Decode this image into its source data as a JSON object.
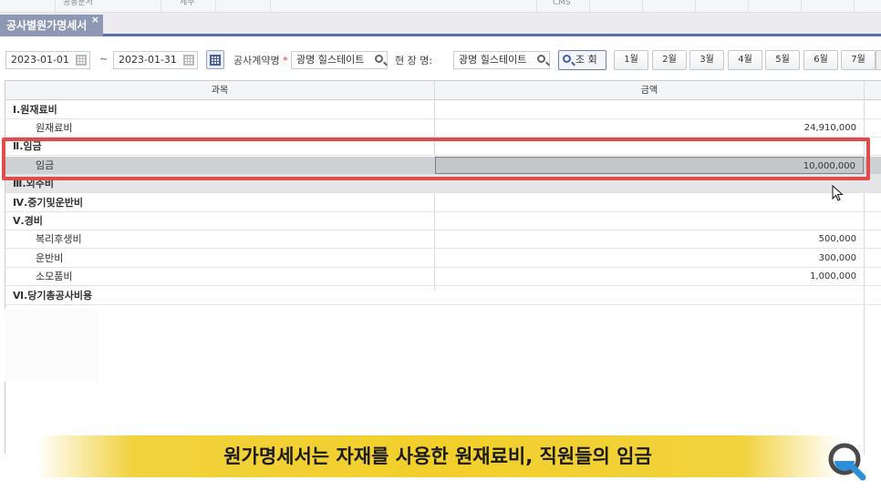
{
  "menu_strip": {
    "fragments": [
      "공통문서",
      "세무",
      "CMS"
    ]
  },
  "tab": {
    "title": "공사별원가명세서",
    "close": "×"
  },
  "toolbar": {
    "date_from": "2023-01-01",
    "separator": "~",
    "date_to": "2023-01-31",
    "contract_label": "공사계약명",
    "required_mark": "*",
    "contract_value": "광명 힐스테이트",
    "site_label": "현 장 명:",
    "site_value": "광명 힐스테이트",
    "query_button": "조 회",
    "months": [
      "1월",
      "2월",
      "3월",
      "4월",
      "5월",
      "6월",
      "7월"
    ]
  },
  "grid": {
    "headers": {
      "subject": "과목",
      "amount": "금액"
    },
    "rows": [
      {
        "kind": "category",
        "label": "Ⅰ.원재료비",
        "amount": ""
      },
      {
        "kind": "item",
        "label": "원재료비",
        "amount": "24,910,000"
      },
      {
        "kind": "category",
        "label": "Ⅱ.임금",
        "amount": ""
      },
      {
        "kind": "item",
        "label": "임금",
        "amount": "10,000,000",
        "selected": true
      },
      {
        "kind": "category",
        "label": "Ⅲ.외주비",
        "amount": ""
      },
      {
        "kind": "category",
        "label": "Ⅳ.중기및운반비",
        "amount": ""
      },
      {
        "kind": "category",
        "label": "Ⅴ.경비",
        "amount": ""
      },
      {
        "kind": "item",
        "label": "복리후생비",
        "amount": "500,000"
      },
      {
        "kind": "item",
        "label": "운반비",
        "amount": "300,000"
      },
      {
        "kind": "item",
        "label": "소모품비",
        "amount": "1,000,000"
      },
      {
        "kind": "category",
        "label": "Ⅵ.당기총공사비용",
        "amount": ""
      }
    ]
  },
  "caption": "원가명세서는 자재를 사용한 원재료비, 직원들의 임금",
  "colors": {
    "highlight": "#e14b4b",
    "caption_bg": "#f2cf2a",
    "tab_bg": "#8e97b3",
    "accent": "#5b6ea8"
  },
  "icons": [
    "calendar-icon",
    "search-icon",
    "mouse-cursor-icon",
    "magnifier-logo-icon"
  ]
}
